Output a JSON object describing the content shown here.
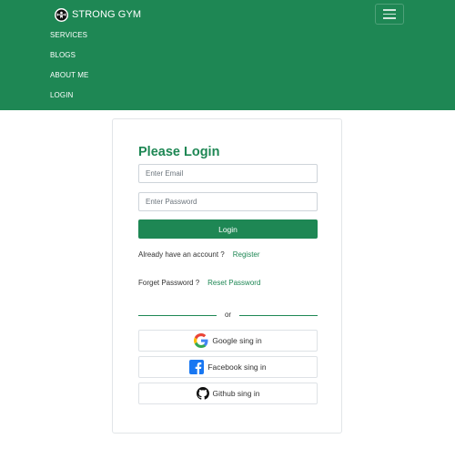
{
  "brand": {
    "name": "STRONG GYM",
    "logo_icon": "weightlifter-icon"
  },
  "nav": {
    "toggler_icon": "hamburger-menu-icon",
    "items": [
      {
        "label": "SERVICES"
      },
      {
        "label": "BLOGS"
      },
      {
        "label": "ABOUT ME"
      },
      {
        "label": "LOGIN"
      }
    ]
  },
  "login": {
    "title": "Please Login",
    "email_placeholder": "Enter Email",
    "email_value": "",
    "password_placeholder": "Enter Password",
    "password_value": "",
    "submit_label": "Login",
    "account_prompt": "Already have an account ?",
    "register_label": "Register",
    "forgot_prompt": "Forget Password ?",
    "reset_label": "Reset Password",
    "divider_text": "or",
    "social": [
      {
        "label": "Google sing in",
        "icon": "google-icon"
      },
      {
        "label": "Facebook sing in",
        "icon": "facebook-icon"
      },
      {
        "label": "Github sing in",
        "icon": "github-icon"
      }
    ]
  },
  "colors": {
    "brand_green": "#1e8754",
    "white": "#ffffff",
    "facebook_blue": "#1877f2"
  }
}
